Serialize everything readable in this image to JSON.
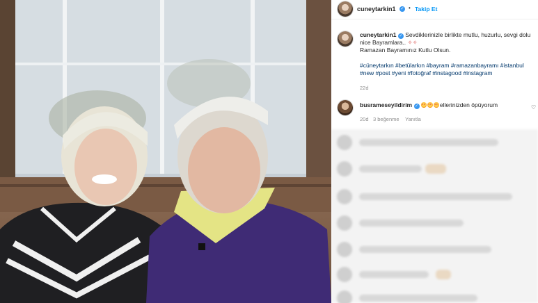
{
  "post": {
    "username": "cuneytarkin1",
    "follow_label": "Takip Et",
    "caption_line1": "Sevdiklerinizle birlikte mutlu, huzurlu, sevgi dolu nice Bayramlara..",
    "caption_line2": "Ramazan Bayramınız Kutlu Olsun.",
    "hashtags": "#cüneytarkın #betülarkın #bayram #ramazanbayramı #istanbul #new #post #yeni #fotoğraf #instagood #instagram",
    "time": "22d"
  },
  "comments": [
    {
      "username": "busrameseyildirim",
      "text": "ellerinizden öpüyorum",
      "time": "20d",
      "likes": "3 beğenme",
      "reply_label": "Yanıtla"
    }
  ],
  "colors": {
    "link_blue": "#0095f6",
    "hashtag_blue": "#00376b",
    "verified_blue": "#3897f0",
    "muted": "#8e8e8e"
  },
  "icons": {
    "verified": "verified-badge-icon",
    "heart": "heart-icon",
    "sparkle": "sparkle-emoji-icon",
    "heart_eyes": "heart-eyes-emoji-icon"
  }
}
